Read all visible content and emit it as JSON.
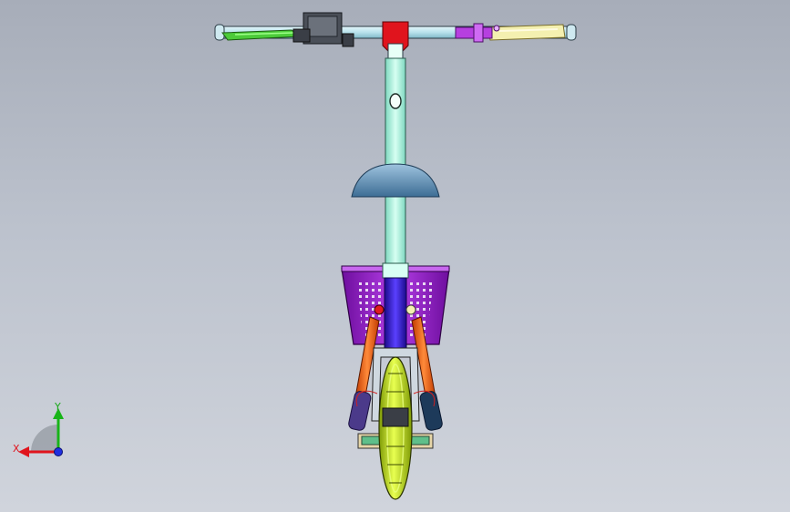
{
  "viewport": {
    "background_top": "#a7adb9",
    "background_bottom": "#d0d4dc",
    "model": {
      "handlebar_color": "#bfe7ef",
      "stem_color": "#baf2e0",
      "head_clamp_color": "#e0141d",
      "fork_color": "#3a1ed6",
      "left_grip_color": "#4ccb3a",
      "right_grip_color": "#f4f0b0",
      "brake_lever_color": "#b63fe0",
      "basket_color": "#9a22c8",
      "fender_color": "#6d99bd",
      "wheel_color": "#c9e51a",
      "strut_color": "#f2641a",
      "shock_color": "#4b3a8a",
      "display_color": "#4a4f58"
    }
  },
  "triad": {
    "x_label": "X",
    "y_label": "Y",
    "x_color": "#e0141d",
    "y_color": "#18b418",
    "z_color": "#1f2fe0"
  }
}
